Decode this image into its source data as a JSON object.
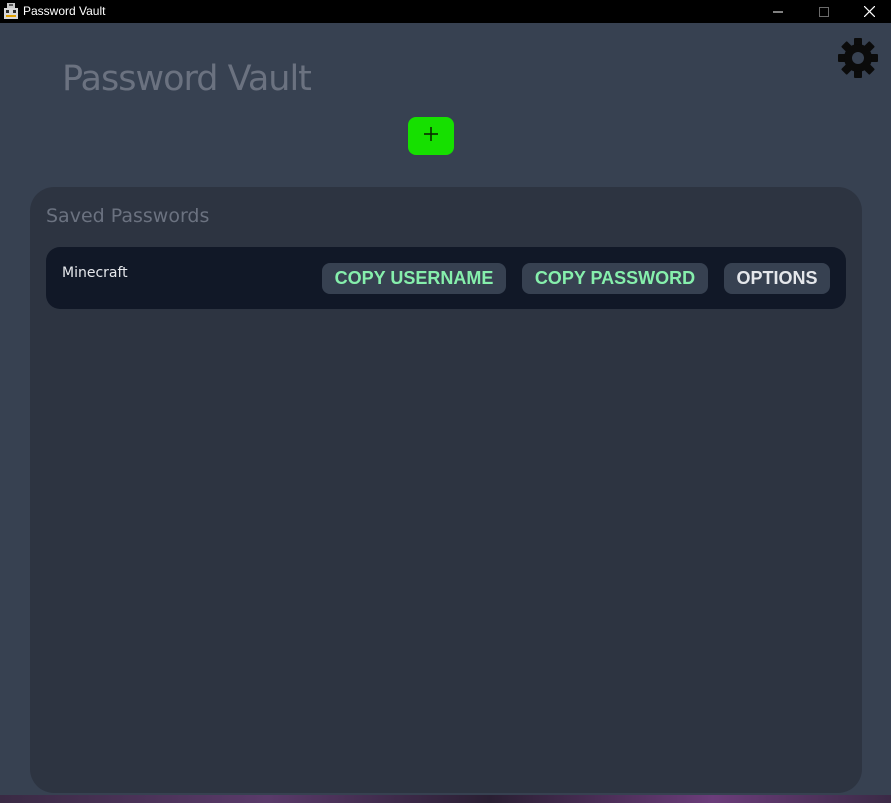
{
  "window": {
    "title": "Password Vault",
    "app_icon": "robot-icon",
    "controls": {
      "minimize_icon": "minimize-icon",
      "maximize_icon": "maximize-icon",
      "close_icon": "close-icon"
    }
  },
  "header": {
    "title": "Password Vault",
    "settings_icon": "gear-icon",
    "add_icon": "plus-icon"
  },
  "saved": {
    "title": "Saved Passwords",
    "entries": [
      {
        "name": "Minecraft",
        "copy_username_label": "COPY USERNAME",
        "copy_password_label": "COPY PASSWORD",
        "options_label": "OPTIONS"
      }
    ]
  },
  "colors": {
    "background": "#374151",
    "panel": "#2d3441",
    "entry": "#111827",
    "add_button": "#16e000",
    "copy_text": "#86efac",
    "title_text": "#6b7280"
  }
}
